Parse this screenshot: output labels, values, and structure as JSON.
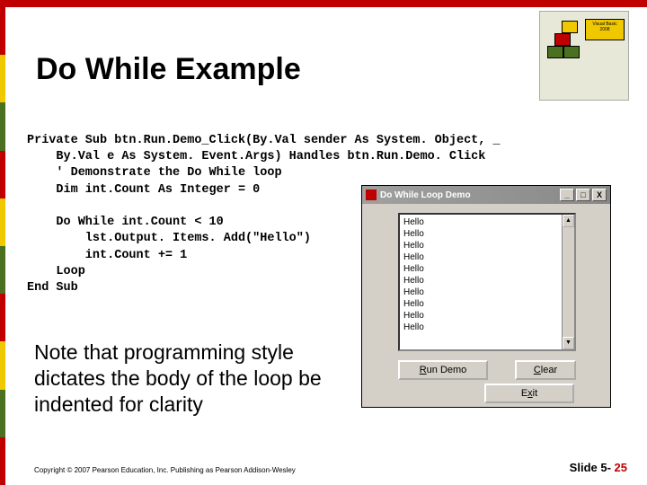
{
  "title": "Do While Example",
  "logo": {
    "label1": "Visual Basic",
    "label2": "2008"
  },
  "code": {
    "l1": "Private Sub btn.Run.Demo_Click(By.Val sender As System. Object, _",
    "l2": "    By.Val e As System. Event.Args) Handles btn.Run.Demo. Click",
    "l3": "    ' Demonstrate the Do While loop",
    "l4": "    Dim int.Count As Integer = 0",
    "l5": "",
    "l6": "    Do While int.Count < 10",
    "l7": "        lst.Output. Items. Add(\"Hello\")",
    "l8": "        int.Count += 1",
    "l9": "    Loop",
    "l10": "End Sub"
  },
  "note": "Note that programming style dictates the body of the loop be indented for clarity",
  "window": {
    "title": "Do While Loop Demo",
    "list_items": [
      "Hello",
      "Hello",
      "Hello",
      "Hello",
      "Hello",
      "Hello",
      "Hello",
      "Hello",
      "Hello",
      "Hello"
    ],
    "buttons": {
      "run": "Run Demo",
      "clear": "Clear",
      "exit": "Exit"
    },
    "controls": {
      "min": "_",
      "max": "□",
      "close": "X"
    },
    "scroll": {
      "up": "▲",
      "down": "▼"
    }
  },
  "copyright": "Copyright © 2007 Pearson Education, Inc. Publishing as Pearson Addison-Wesley",
  "slide": {
    "label": "Slide 5- ",
    "num": "25"
  }
}
